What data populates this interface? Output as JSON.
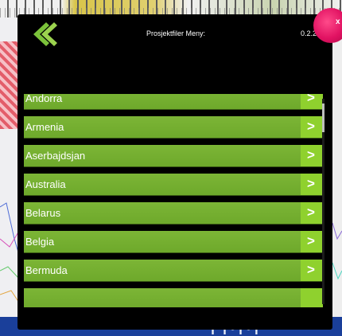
{
  "dialog": {
    "title": "Prosjektfiler Meny:",
    "version": "0.2.2",
    "close_label": "x",
    "back_icon": "back-chevron-icon"
  },
  "countries": [
    {
      "label": "Andorra"
    },
    {
      "label": "Armenia"
    },
    {
      "label": "Aserbajdsjan"
    },
    {
      "label": "Australia"
    },
    {
      "label": "Belarus"
    },
    {
      "label": "Belgia"
    },
    {
      "label": "Bermuda"
    }
  ],
  "row_arrow": ">",
  "colors": {
    "row": "#7cb536",
    "row_arrow": "#8fd12e",
    "close": "#e11262",
    "dialog_bg": "#000000"
  }
}
